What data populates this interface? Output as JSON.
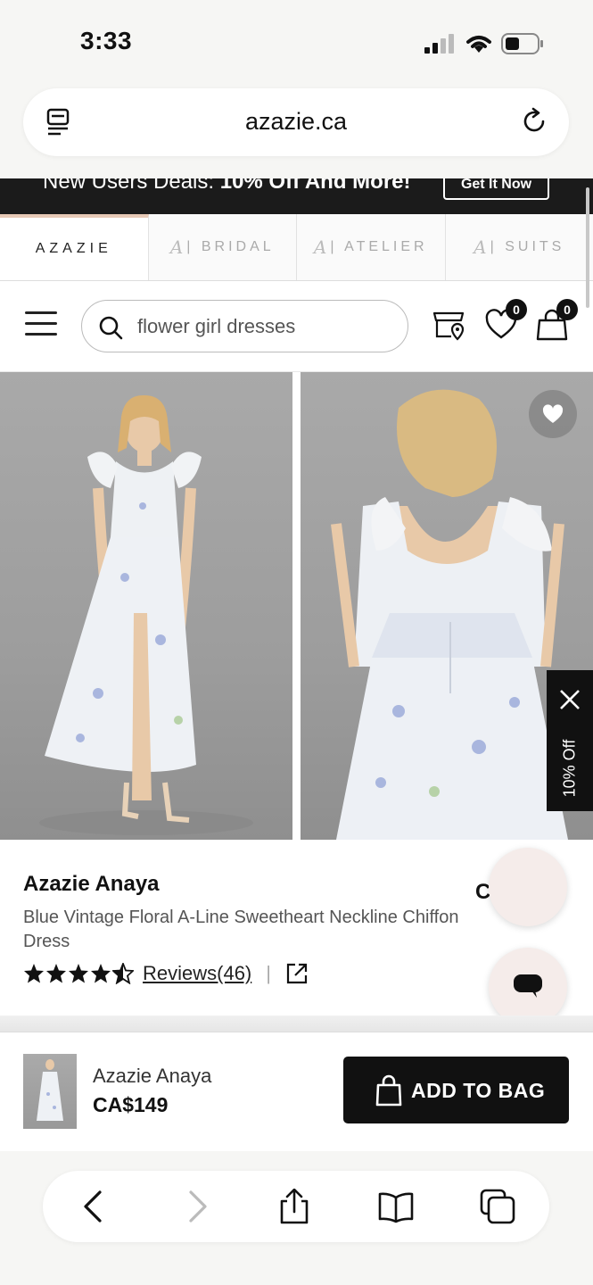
{
  "status_bar": {
    "time": "3:33"
  },
  "browser": {
    "domain": "azazie.ca"
  },
  "promo": {
    "text_prefix": "New Users Deals: ",
    "text_bold": "10% Off And More!",
    "cta": "Get It Now"
  },
  "brand_tabs": [
    {
      "label": "AZAZIE",
      "active": true
    },
    {
      "label": "| BRIDAL",
      "active": false
    },
    {
      "label": "| ATELIER",
      "active": false
    },
    {
      "label": "| SUITS",
      "active": false
    }
  ],
  "search": {
    "value": "flower girl dresses"
  },
  "nav": {
    "wishlist_count": "0",
    "cart_count": "0"
  },
  "discount_tab": {
    "label": "10% Off"
  },
  "product": {
    "brand": "Azazie Anaya",
    "title": "Blue Vintage Floral A-Line Sweetheart Neckline Chiffon Dress",
    "rating": 4.5,
    "reviews_label": "Reviews(46)",
    "price_peek": "C"
  },
  "sticky_bar": {
    "name": "Azazie Anaya",
    "price": "CA$149",
    "button_label": "ADD TO BAG"
  },
  "colors": {
    "dark": "#111111",
    "accent": "#e7c9b6"
  }
}
